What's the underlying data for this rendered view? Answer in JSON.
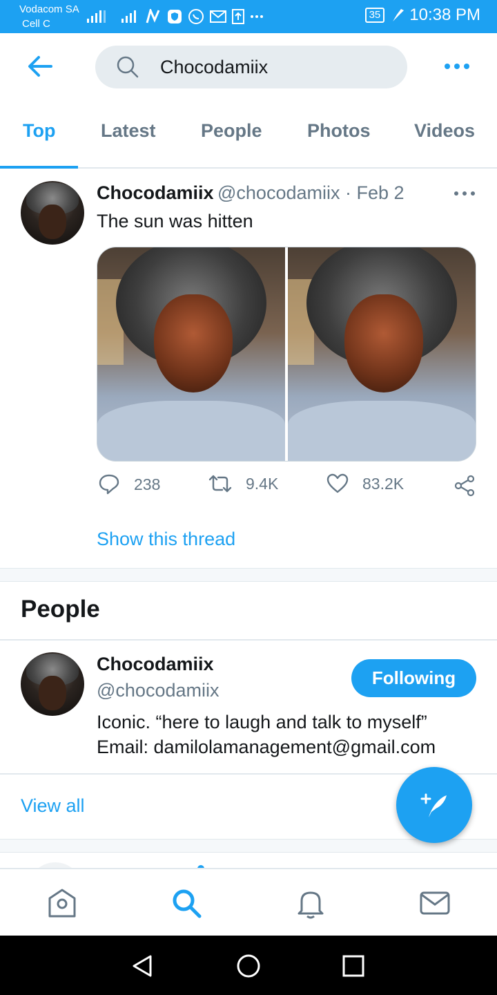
{
  "status_bar": {
    "carrier_line1": "Vodacom SA",
    "carrier_line2": "Cell C",
    "battery": "35",
    "time": "10:38 PM",
    "color": "#1da1f2"
  },
  "search": {
    "query": "Chocodamiix"
  },
  "tabs": [
    {
      "label": "Top"
    },
    {
      "label": "Latest"
    },
    {
      "label": "People"
    },
    {
      "label": "Photos"
    },
    {
      "label": "Videos"
    }
  ],
  "active_tab": "Top",
  "tweet": {
    "display_name": "Chocodamiix",
    "handle_date": "@chocodamiix · Feb 2",
    "text": "The sun was hitten",
    "replies": "238",
    "retweets": "9.4K",
    "likes": "83.2K",
    "show_thread": "Show this thread"
  },
  "people_section": {
    "heading": "People",
    "user": {
      "display_name": "Chocodamiix",
      "handle": "@chocodamiix",
      "bio_line1": "Iconic. “here to laugh and talk to myself”",
      "bio_line2": "Email: damilolamanagement@gmail.com",
      "follow_label": "Following"
    },
    "view_all": "View all"
  },
  "icons": {
    "accent": "#1da1f2",
    "muted": "#657786",
    "nav": [
      "home-icon",
      "search-icon",
      "bell-icon",
      "mail-icon"
    ],
    "android": [
      "back-triangle-icon",
      "home-circle-icon",
      "recents-square-icon"
    ]
  }
}
